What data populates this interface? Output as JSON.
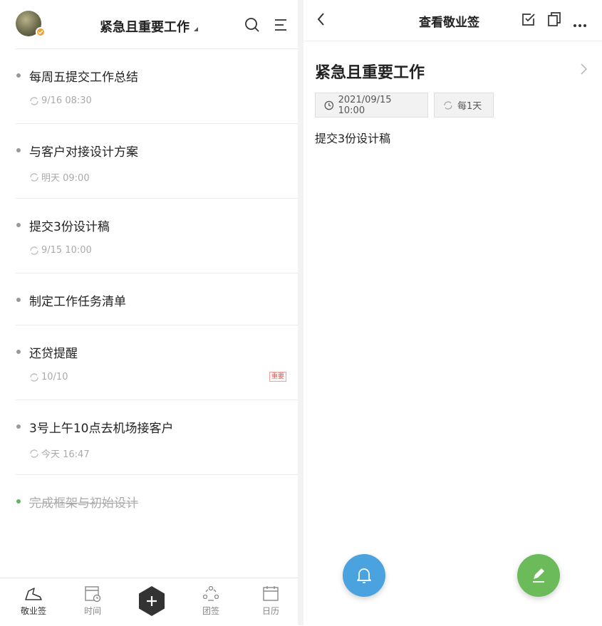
{
  "left": {
    "header": {
      "title": "紧急且重要工作"
    },
    "items": [
      {
        "title": "每周五提交工作总结",
        "meta": "9/16 08:30",
        "size": "tall"
      },
      {
        "title": "与客户对接设计方案",
        "meta": "明天 09:00",
        "size": "tall"
      },
      {
        "title": "提交3份设计稿",
        "meta": "9/15 10:00",
        "size": "tall"
      },
      {
        "title": "制定工作任务清单",
        "meta": "",
        "size": "short"
      },
      {
        "title": "还贷提醒",
        "meta": "10/10",
        "tag": "重要",
        "size": "tall"
      },
      {
        "title": "3号上午10点去机场接客户",
        "meta": "今天 16:47",
        "size": "tall"
      },
      {
        "title": "完成框架与初始设计",
        "meta": "",
        "size": "short",
        "done": true
      }
    ],
    "tabs": [
      {
        "label": "敬业签",
        "icon": "note-bird-icon"
      },
      {
        "label": "时间",
        "icon": "calendar-clock-icon"
      },
      {
        "label": "团签",
        "icon": "team-icon"
      },
      {
        "label": "日历",
        "icon": "calendar-icon"
      }
    ]
  },
  "right": {
    "header": {
      "title": "查看敬业签"
    },
    "note": {
      "title": "紧急且重要工作",
      "datetime": "2021/09/15 10:00",
      "repeat": "每1天",
      "body": "提交3份设计稿"
    }
  },
  "colors": {
    "bell_fab": "#4aa3df",
    "edit_fab": "#6cbb5a",
    "done_dot": "#5cb85c",
    "tag_red": "#e25a4e"
  }
}
